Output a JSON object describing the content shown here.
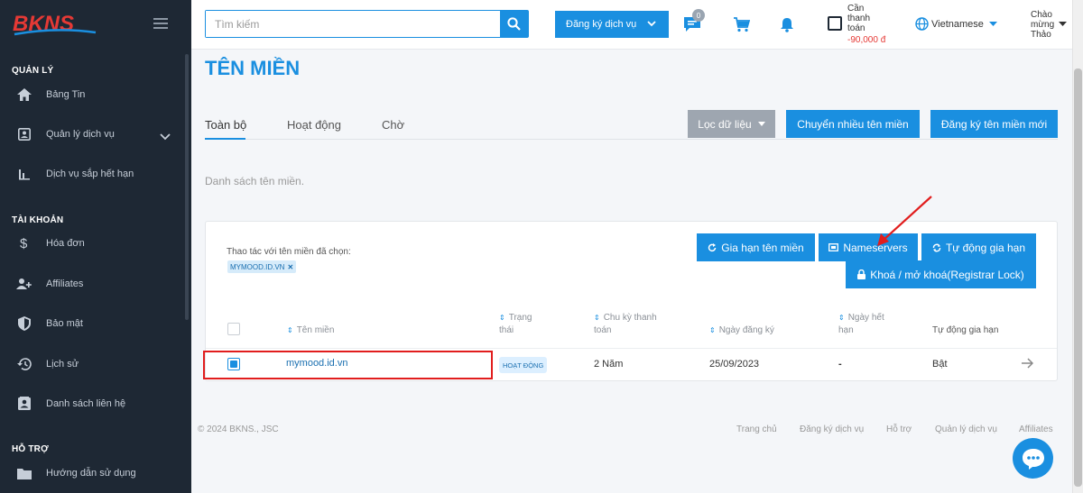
{
  "brand": {
    "logo_text": "BKNS"
  },
  "sidebar": {
    "sections": [
      "QUẢN LÝ",
      "TÀI KHOẢN",
      "HỖ TRỢ"
    ],
    "items": [
      {
        "label": "Bảng Tin",
        "icon": "home-icon"
      },
      {
        "label": "Quản lý dịch vụ",
        "icon": "account-box-icon"
      },
      {
        "label": "Dịch vụ sắp hết hạn",
        "icon": "bar-chart-icon"
      },
      {
        "label": "Hóa đơn",
        "icon": "dollar-icon"
      },
      {
        "label": "Affiliates",
        "icon": "user-plus-icon"
      },
      {
        "label": "Bảo mật",
        "icon": "shield-icon"
      },
      {
        "label": "Lịch sử",
        "icon": "history-icon"
      },
      {
        "label": "Danh sách liên hệ",
        "icon": "contacts-icon"
      },
      {
        "label": "Hướng dẫn sử dụng",
        "icon": "folder-icon"
      }
    ]
  },
  "header": {
    "search_placeholder": "Tìm kiếm",
    "register_service_label": "Đăng ký dịch vụ",
    "message_badge": "0",
    "pay_text": [
      "Cần",
      "thanh",
      "toán"
    ],
    "pay_amount": "-90,000 đ",
    "language": "Vietnamese",
    "welcome": [
      "Chào",
      "mừng",
      "Thảo"
    ]
  },
  "main": {
    "title": "TÊN MIỀN",
    "tabs": [
      "Toàn bộ",
      "Hoạt động",
      "Chờ"
    ],
    "filter_label": "Lọc dữ liệu",
    "transfer_label": "Chuyển nhiều tên miền",
    "register_domain_label": "Đăng ký tên miền mới",
    "list_description": "Danh sách tên miền.",
    "selection_label": "Thao tác với tên miền đã chọn:",
    "selected_chip": "MYMOOD.ID.VN",
    "actions": {
      "renew": "Gia hạn tên miền",
      "nameservers": "Nameservers",
      "auto_renew": "Tự động gia hạn",
      "lock": "Khoá / mở khoá(Registrar Lock)"
    },
    "table": {
      "headers": {
        "domain": "Tên miền",
        "status": [
          "Trạng",
          "thái"
        ],
        "cycle": [
          "Chu kỳ thanh",
          "toán"
        ],
        "registered": "Ngày đăng ký",
        "expiry": [
          "Ngày hết",
          "hạn"
        ],
        "auto_renew": "Tự động gia hạn"
      },
      "rows": [
        {
          "domain": "mymood.id.vn",
          "status": "HOẠT ĐỘNG",
          "cycle": "2 Năm",
          "registered": "25/09/2023",
          "expiry": "-",
          "auto_renew": "Bật",
          "checked": true
        }
      ]
    }
  },
  "footer": {
    "copyright": "© 2024 BKNS., JSC",
    "links": [
      "Trang chủ",
      "Đăng ký dịch vụ",
      "Hỗ trợ",
      "Quản lý dịch vụ",
      "Affiliates"
    ]
  },
  "colors": {
    "accent": "#1a8fe0",
    "sidebar_bg": "#1e2834",
    "danger": "#e53935",
    "annotation": "#e11d1d"
  }
}
